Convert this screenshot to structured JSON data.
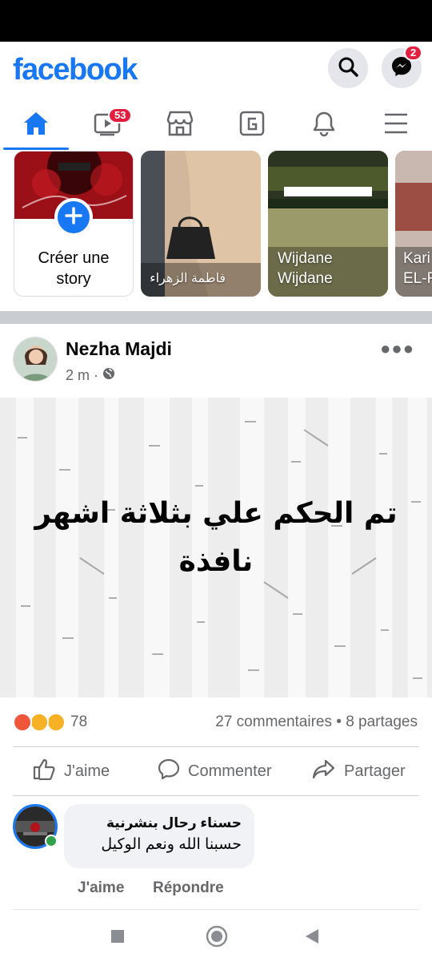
{
  "app": {
    "logo": "facebook",
    "brand_color": "#1877f2"
  },
  "header": {
    "search_icon": "search-icon",
    "messenger_icon": "messenger-icon",
    "messenger_badge": "2"
  },
  "nav": {
    "items": [
      {
        "icon": "home-icon",
        "active": true
      },
      {
        "icon": "video-icon",
        "badge": "53"
      },
      {
        "icon": "marketplace-icon"
      },
      {
        "icon": "groups-icon"
      },
      {
        "icon": "bell-icon"
      },
      {
        "icon": "menu-icon"
      }
    ]
  },
  "stories": {
    "create_label": "Créer une story",
    "items": [
      {
        "name": "فاطمة الزهراء"
      },
      {
        "name": "Wijdane Wijdane"
      },
      {
        "name": "Kari EL-F"
      }
    ]
  },
  "post": {
    "author": "Nezha Majdi",
    "time": "2 m",
    "privacy_icon": "globe-icon",
    "text_line1": "تم الحكم علي بثلاثة اشهر",
    "text_line2": "نافذة",
    "reactions_count": "78",
    "reaction_icons": [
      "angry-icon",
      "wow-icon",
      "sad-icon"
    ],
    "comments_shares": "27 commentaires • 8 partages",
    "actions": {
      "like": "J'aime",
      "comment": "Commenter",
      "share": "Partager"
    }
  },
  "comment": {
    "author": "حسناء رحال بنشرنية",
    "text": "حسبنا الله ونعم الوكيل",
    "like": "J'aime",
    "reply": "Répondre"
  }
}
